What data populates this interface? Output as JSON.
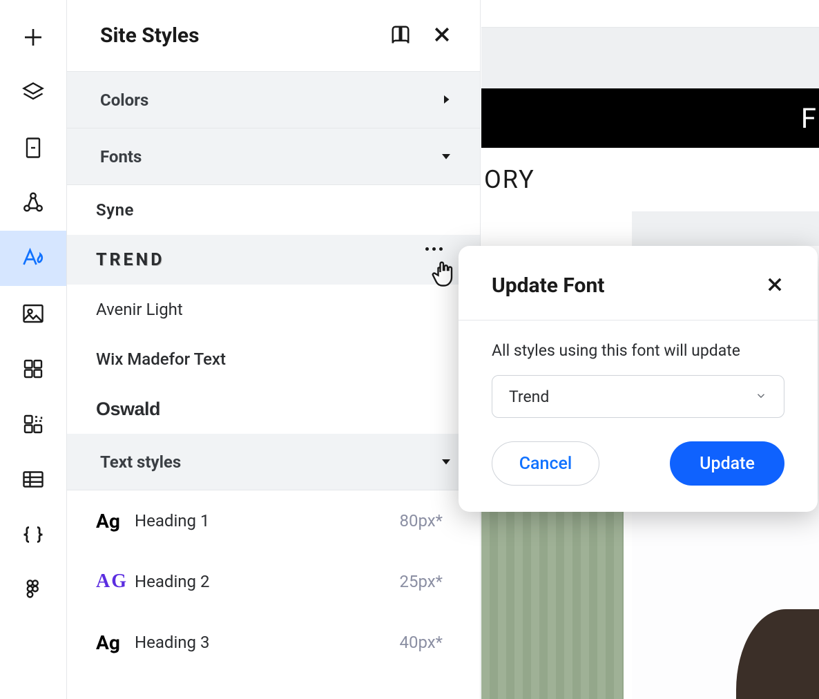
{
  "panel": {
    "title": "Site Styles",
    "sections": {
      "colors": "Colors",
      "fonts": "Fonts",
      "textStyles": "Text styles"
    },
    "fonts": [
      {
        "label": "Syne",
        "class": "syne"
      },
      {
        "label": "TREND",
        "class": "trend",
        "hovered": true
      },
      {
        "label": "Avenir Light",
        "class": "avenir"
      },
      {
        "label": "Wix Madefor Text",
        "class": "wixmade"
      },
      {
        "label": "Oswald",
        "class": "oswald"
      }
    ],
    "textStyles": [
      {
        "ag": "Ag",
        "label": "Heading 1",
        "size": "80px*"
      },
      {
        "ag": "AG",
        "label": "Heading 2",
        "size": "25px*"
      },
      {
        "ag": "Ag",
        "label": "Heading 3",
        "size": "40px*"
      }
    ]
  },
  "canvas": {
    "blackStripText": "F",
    "whiteStripText": "ORY"
  },
  "modal": {
    "title": "Update Font",
    "description": "All styles using this font will update",
    "selectValue": "Trend",
    "cancel": "Cancel",
    "update": "Update"
  },
  "colors": {
    "accent": "#0f62fe",
    "railActiveBg": "#d6e6ff",
    "railActiveFg": "#1172ff"
  }
}
